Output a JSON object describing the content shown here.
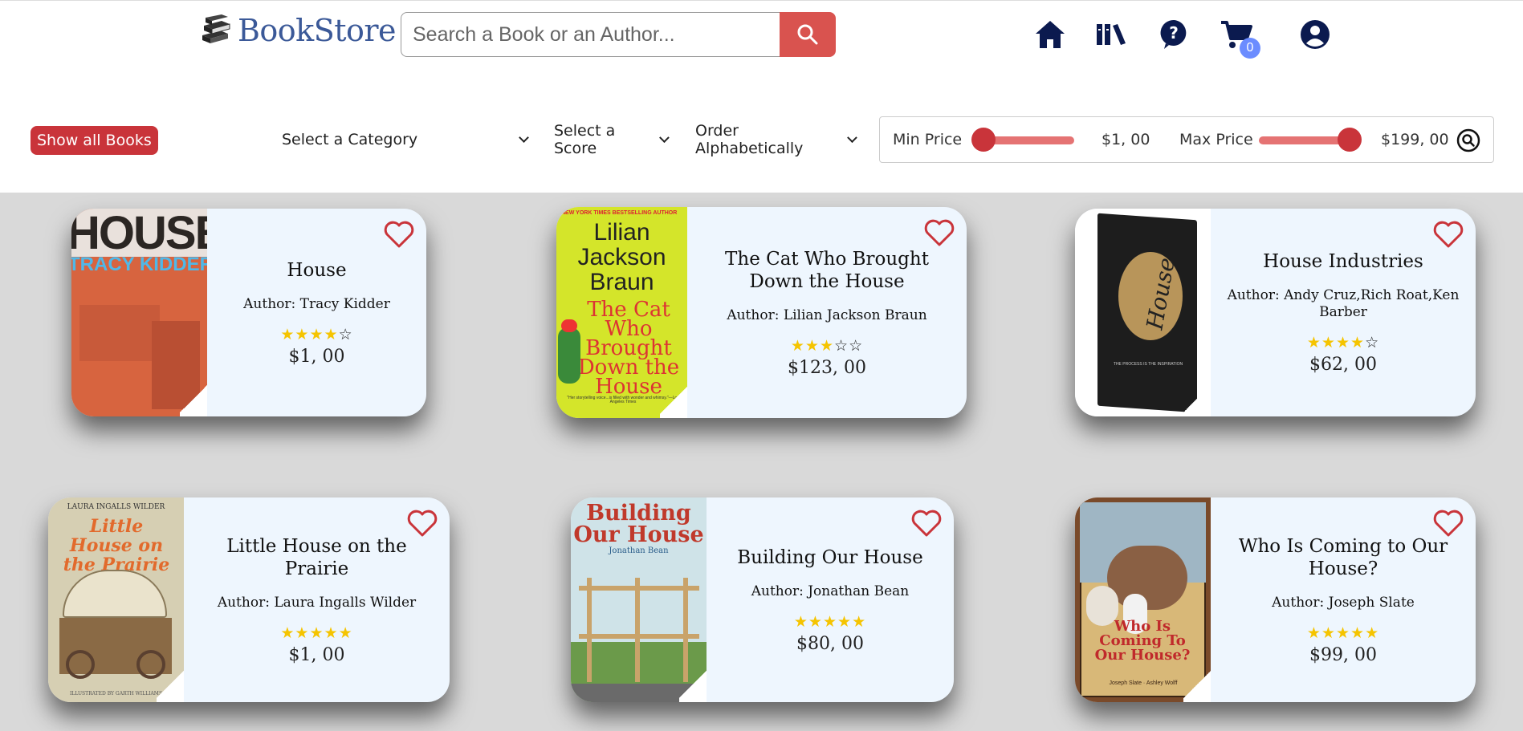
{
  "header": {
    "logo_text": "BookStore",
    "search_placeholder": "Search a Book or an Author...",
    "cart_count": "0",
    "nav_icons": [
      "home-icon",
      "library-icon",
      "help-icon",
      "cart-icon",
      "account-icon"
    ]
  },
  "filters": {
    "show_all_label": "Show all Books",
    "category_label": "Select a Category",
    "score_label": "Select a Score",
    "order_label": "Order Alphabetically",
    "min_price_label": "Min Price",
    "max_price_label": "Max Price",
    "min_price_value": "$1, 00",
    "max_price_value": "$199, 00"
  },
  "colors": {
    "brand": "#3b5998",
    "accent": "#d9534f",
    "card_bg": "#eef6fe",
    "star": "#f5c400"
  },
  "books": [
    {
      "title": "House",
      "author": "Author: Tracy Kidder",
      "rating": 4,
      "price": "$1, 00",
      "cover_lines": [
        "HOUSE",
        "TRACY KIDDER"
      ]
    },
    {
      "title": "The Cat Who Brought Down the House",
      "author": "Author: Lilian Jackson Braun",
      "rating": 3,
      "price": "$123, 00",
      "cover_lines": [
        "NEW YORK TIMES BESTSELLING AUTHOR",
        "Lilian Jackson Braun",
        "The Cat Who Brought Down the House",
        "\"Her storytelling voice...is filled with wonder and whimsy.\"—Los Angeles Times"
      ]
    },
    {
      "title": "House Industries",
      "author": "Author: Andy Cruz,Rich Roat,Ken Barber",
      "rating": 4,
      "price": "$62, 00",
      "cover_lines": [
        "House",
        "THE PROCESS IS THE INSPIRATION"
      ]
    },
    {
      "title": "Little House on the Prairie",
      "author": "Author: Laura Ingalls Wilder",
      "rating": 5,
      "price": "$1, 00",
      "cover_lines": [
        "LAURA INGALLS WILDER",
        "Little House on the Prairie",
        "ILLUSTRATED BY GARTH WILLIAMS"
      ]
    },
    {
      "title": "Building Our House",
      "author": "Author: Jonathan Bean",
      "rating": 5,
      "price": "$80, 00",
      "cover_lines": [
        "Building Our House",
        "Jonathan Bean"
      ]
    },
    {
      "title": "Who Is Coming to Our House?",
      "author": "Author: Joseph Slate",
      "rating": 5,
      "price": "$99, 00",
      "cover_lines": [
        "Who Is Coming To Our House?",
        "Joseph Slate · Ashley Wolff"
      ]
    }
  ]
}
